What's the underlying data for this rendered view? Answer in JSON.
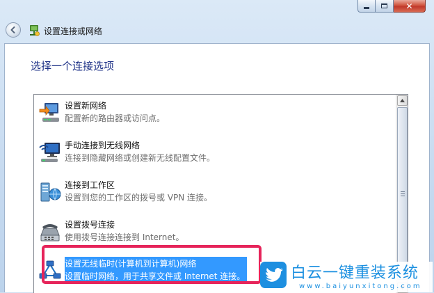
{
  "window": {
    "title": "设置连接或网络",
    "caption": {
      "close": "✕"
    }
  },
  "page": {
    "instruction": "选择一个连接选项"
  },
  "options": [
    {
      "title": "设置新网络",
      "description": "配置新的路由器或访问点。",
      "icon": "router-icon",
      "selected": false
    },
    {
      "title": "手动连接到无线网络",
      "description": "连接到隐藏网络或创建新无线配置文件。",
      "icon": "wireless-monitor-icon",
      "selected": false
    },
    {
      "title": "连接到工作区",
      "description": "设置到您的工作区的拨号或 VPN 连接。",
      "icon": "workplace-icon",
      "selected": false
    },
    {
      "title": "设置拨号连接",
      "description": "使用拨号连接连接到 Internet。",
      "icon": "phone-modem-icon",
      "selected": false
    },
    {
      "title": "设置无线临时(计算机到计算机)网络",
      "description": "设置临时网络，用于共享文件或 Internet 连接。",
      "icon": "adhoc-network-icon",
      "selected": true
    }
  ],
  "watermark": {
    "title": "白云一键重装系统",
    "url": "www.baiyunxitong.com"
  },
  "colors": {
    "selection": "#3399ff",
    "highlight_box": "#e6245a",
    "instruction": "#1e3287",
    "brand": "#1a8fe0"
  }
}
